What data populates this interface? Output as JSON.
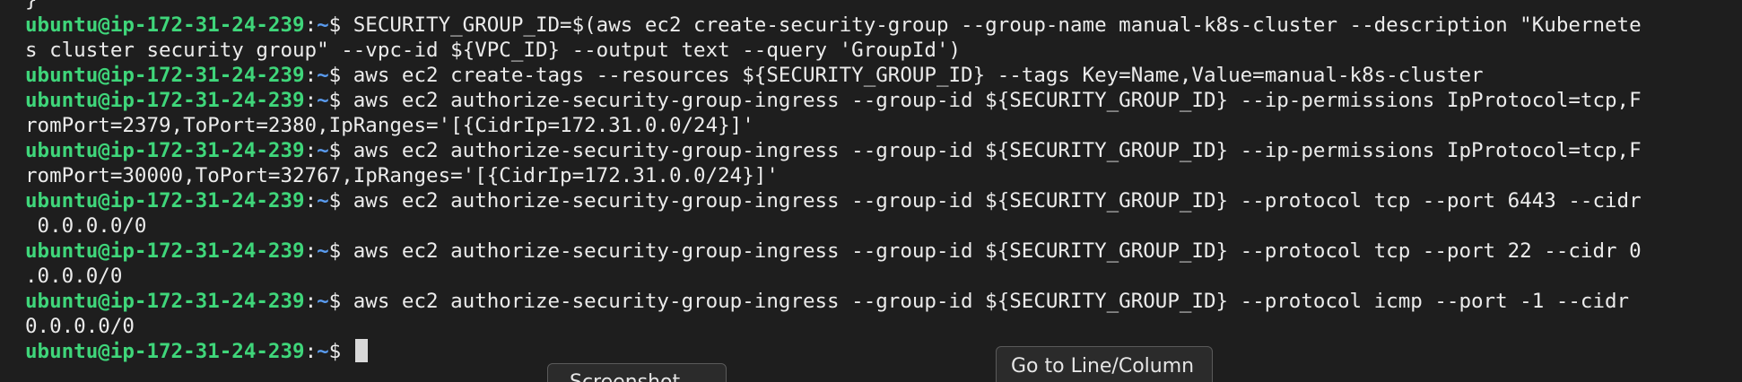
{
  "terminal": {
    "prompt_user_host": "ubuntu@ip-172-31-24-239",
    "prompt_sep": ":",
    "prompt_dir": "~",
    "prompt_symbol": "$ ",
    "top_fragment": "}",
    "commands": [
      {
        "text": "SECURITY_GROUP_ID=$(aws ec2 create-security-group --group-name manual-k8s-cluster --description \"Kubernete",
        "wrap": "s cluster security group\" --vpc-id ${VPC_ID} --output text --query 'GroupId')"
      },
      {
        "text": "aws ec2 create-tags --resources ${SECURITY_GROUP_ID} --tags Key=Name,Value=manual-k8s-cluster"
      },
      {
        "text": "aws ec2 authorize-security-group-ingress --group-id ${SECURITY_GROUP_ID} --ip-permissions IpProtocol=tcp,F",
        "wrap": "romPort=2379,ToPort=2380,IpRanges='[{CidrIp=172.31.0.0/24}]'"
      },
      {
        "text": "aws ec2 authorize-security-group-ingress --group-id ${SECURITY_GROUP_ID} --ip-permissions IpProtocol=tcp,F",
        "wrap": "romPort=30000,ToPort=32767,IpRanges='[{CidrIp=172.31.0.0/24}]'"
      },
      {
        "text": "aws ec2 authorize-security-group-ingress --group-id ${SECURITY_GROUP_ID} --protocol tcp --port 6443 --cidr",
        "wrap": " 0.0.0.0/0"
      },
      {
        "text": "aws ec2 authorize-security-group-ingress --group-id ${SECURITY_GROUP_ID} --protocol tcp --port 22 --cidr 0",
        "wrap": ".0.0.0/0"
      },
      {
        "text": "aws ec2 authorize-security-group-ingress --group-id ${SECURITY_GROUP_ID} --protocol icmp --port -1 --cidr",
        "wrap": "0.0.0.0/0"
      }
    ]
  },
  "overlays": {
    "screenshot_label": "Screenshot",
    "goto_label": "Go to Line/Column"
  },
  "colors": {
    "background": "#1e1e1e",
    "prompt_user": "#3fd67a",
    "prompt_dir": "#5a9cf0",
    "text": "#ececec"
  }
}
